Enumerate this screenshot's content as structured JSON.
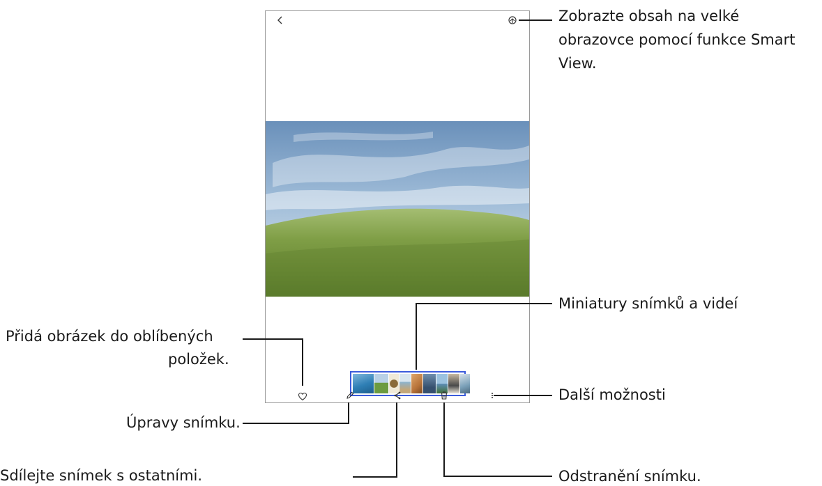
{
  "callouts": {
    "smart_view": [
      "Zobrazte obsah na velké",
      "obrazovce pomocí funkce Smart",
      "View."
    ],
    "thumbnails": "Miniatury snímků a videí",
    "favorite": [
      "Přidá obrázek do oblíbených",
      "položek."
    ],
    "more_options": "Další možnosti",
    "edit": "Úpravy snímku.",
    "delete": "Odstranění snímku.",
    "share": "Sdílejte snímek s ostatními."
  },
  "icons": {
    "back": "back-arrow-icon",
    "smart_view": "smart-view-icon",
    "favorite": "heart-icon",
    "edit": "pencil-icon",
    "share": "share-icon",
    "delete": "trash-icon",
    "more": "more-vertical-icon"
  },
  "thumbnail_colors": [
    "#2f7fb5",
    "#6c9b3f",
    "#c9b48a",
    "#8ab3cf",
    "#b8743a",
    "#36506e",
    "#5d8db5",
    "#4a4a4a",
    "#7aa0b8"
  ],
  "colors": {
    "thumbnail_border": "#3b5bdb",
    "callout_line": "#1a1a1a",
    "frame": "#9a9a9a"
  }
}
